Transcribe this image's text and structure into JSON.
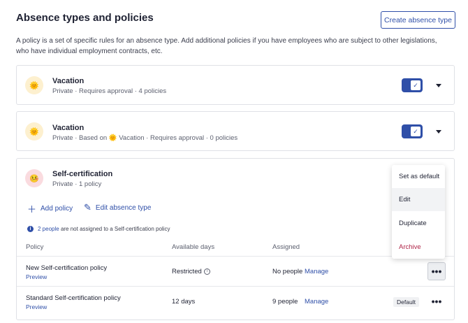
{
  "header": {
    "title": "Absence types and policies",
    "create_button": "Create absence type",
    "description": "A policy is a set of specific rules for an absence type. Add additional policies if you have employees who are subject to other legislations, who have individual employment contracts, etc."
  },
  "absence_types": [
    {
      "emoji": "🌞",
      "name": "Vacation",
      "subtitle": "Private · Requires approval · 4 policies",
      "enabled": true
    },
    {
      "emoji": "🌞",
      "name": "Vacation",
      "subtitle_prefix": "Private · Based on",
      "subtitle_suffix": "Vacation · Requires approval · 0 policies",
      "enabled": true
    },
    {
      "emoji": "🤒",
      "name": "Self-certification",
      "subtitle": "Private · 1 policy"
    }
  ],
  "expanded": {
    "add_policy": "Add policy",
    "edit_type": "Edit absence type",
    "notice_link": "2 people",
    "notice_text": "are not assigned to a Self-certification policy",
    "columns": [
      "Policy",
      "Available days",
      "Assigned"
    ],
    "rows": [
      {
        "name": "New Self-certification policy",
        "preview": "Preview",
        "days": "Restricted",
        "assigned": "No people",
        "manage": "Manage"
      },
      {
        "name": "Standard Self-certification policy",
        "preview": "Preview",
        "days": "12 days",
        "assigned": "9 people",
        "manage": "Manage",
        "badge": "Default"
      }
    ]
  },
  "menu": {
    "items": [
      "Set as default",
      "Edit",
      "Duplicate",
      "Archive"
    ]
  },
  "colors": {
    "accent": "#2f4fa8",
    "danger": "#b0274a"
  }
}
